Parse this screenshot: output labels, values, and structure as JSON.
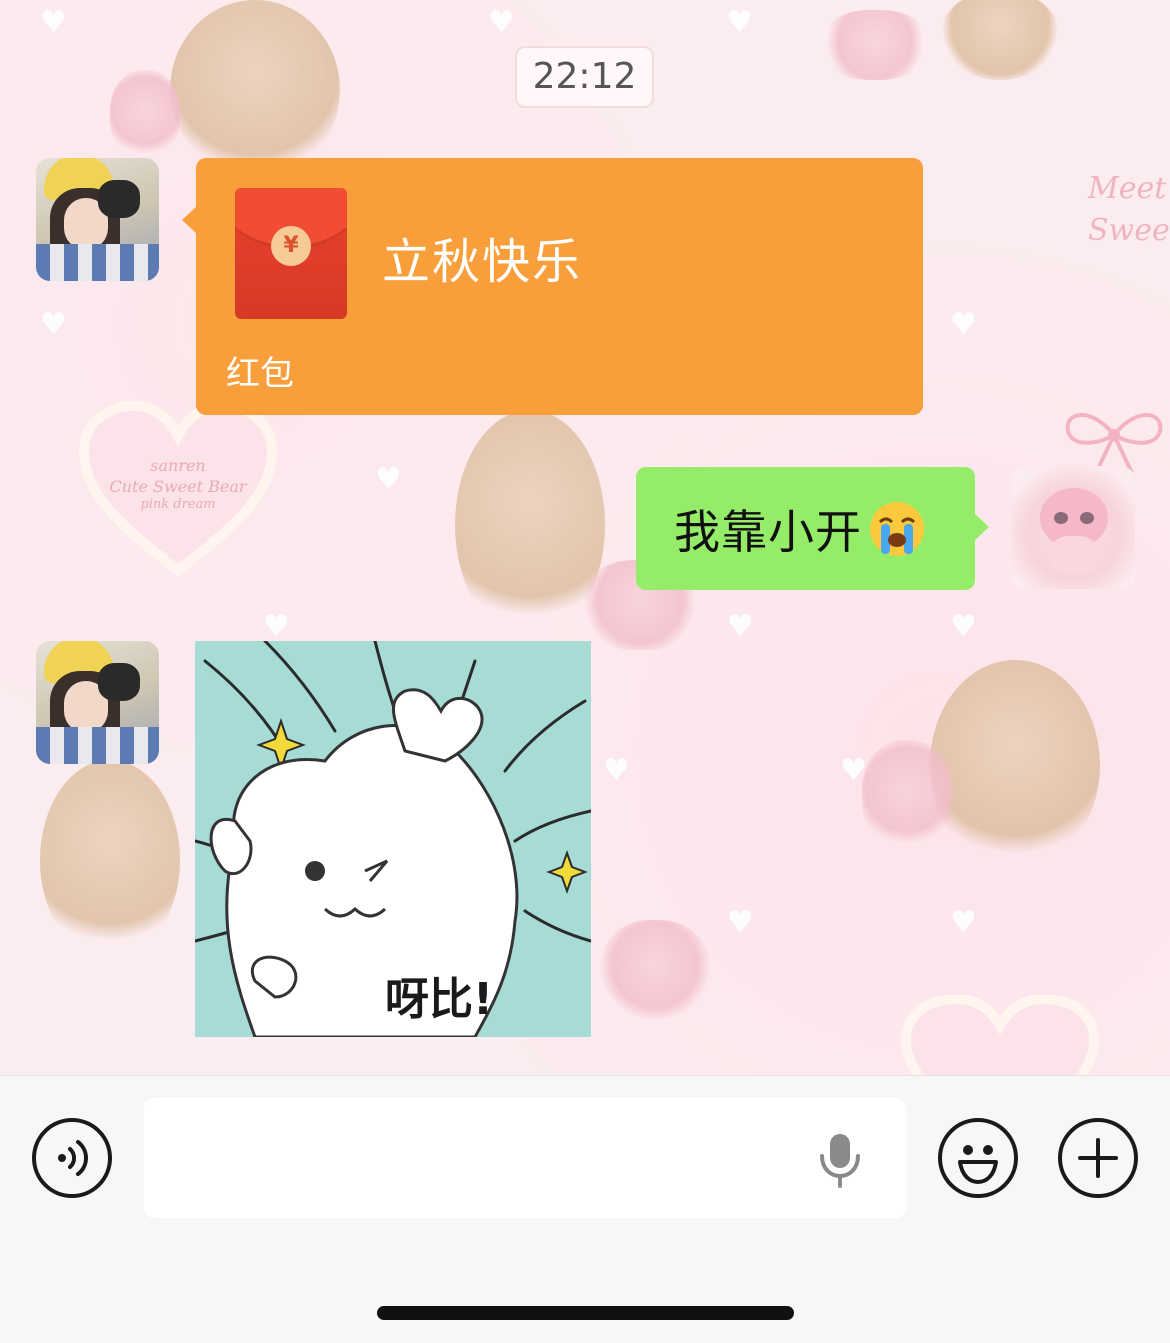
{
  "chat": {
    "timestamp": "22:12",
    "red_packet": {
      "title": "立秋快乐",
      "label": "红包",
      "coin_symbol": "¥"
    },
    "my_message": {
      "text": "我靠小开",
      "emoji": "loudly-crying-face"
    },
    "sticker": {
      "caption": "呀比!"
    }
  },
  "wallpaper": {
    "heart_text_1": "sanren",
    "heart_text_2": "Cute Sweet Bear",
    "heart_text_3": "pink dream",
    "corner_text": "Meet y\nSweet"
  },
  "input_bar": {
    "placeholder": "",
    "voice_icon": "voice-wave-icon",
    "mic_icon": "microphone-icon",
    "emoji_icon": "smiley-icon",
    "plus_icon": "plus-icon"
  },
  "colors": {
    "red_packet_bubble": "#f89e3a",
    "my_bubble": "#95ec69",
    "wallpaper": "#fbecef"
  }
}
